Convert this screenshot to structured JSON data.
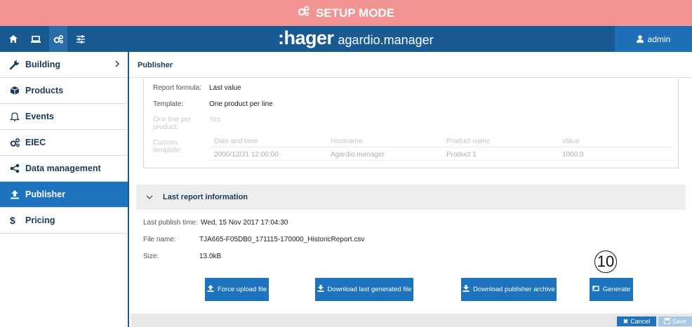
{
  "banner": {
    "title": "SETUP MODE"
  },
  "topbar": {
    "brand_logo": ":hager",
    "brand_sub": "agardio.manager",
    "user": "admin"
  },
  "sidebar": {
    "items": [
      {
        "label": "Building"
      },
      {
        "label": "Products"
      },
      {
        "label": "Events"
      },
      {
        "label": "EIEC"
      },
      {
        "label": "Data management"
      },
      {
        "label": "Publisher"
      },
      {
        "label": "Pricing"
      }
    ]
  },
  "page": {
    "title": "Publisher"
  },
  "config": {
    "report_formula_label": "Report formula:",
    "report_formula_value": "Last value",
    "template_label": "Template:",
    "template_value": "One product per line",
    "one_line_label": "One line per product:",
    "one_line_value": "Yes",
    "custom_template_label": "Custom template:",
    "template_columns": [
      "Date and time",
      "Hostname",
      "Product name",
      "Value"
    ],
    "template_row": [
      "2000/12/31 12:00:00",
      "Agardio.manager",
      "Product 1",
      "1000.0"
    ]
  },
  "last_report": {
    "section_title": "Last report information",
    "publish_time_label": "Last publish time:",
    "publish_time_value": "Wed, 15 Nov 2017 17:04:30",
    "file_name_label": "File name:",
    "file_name_value": "TJA665-F05DB0_171115-170000_HistoricReport.csv",
    "size_label": "Size:",
    "size_value": "13.0kB"
  },
  "actions": {
    "force_upload": "Force upload file",
    "download_last": "Download last generated file",
    "download_archive": "Download publisher archive",
    "generate": "Generate"
  },
  "callout": {
    "number": "10"
  },
  "footer": {
    "cancel": "Cancel",
    "save": "Save"
  },
  "colors": {
    "banner": "#f19493",
    "topbar": "#1a5a93",
    "accent": "#1e73be"
  }
}
